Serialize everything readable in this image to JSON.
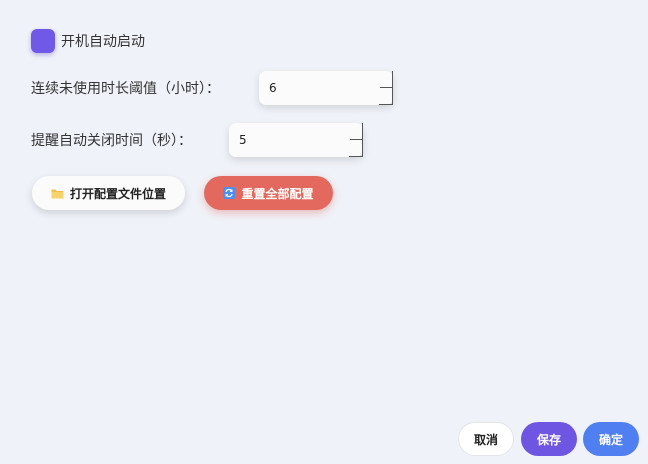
{
  "autostart": {
    "checked": true,
    "label": "开机自动启动",
    "color": "#7159e8"
  },
  "settings": [
    {
      "label": "连续未使用时长阈值（小时）：",
      "value": "6"
    },
    {
      "label": "提醒自动关闭时间（秒）：",
      "value": "5"
    }
  ],
  "actions": {
    "open_config_label": "打开配置文件位置",
    "open_config_icon": "folder-icon",
    "reset_label": "重置全部配置",
    "reset_icon": "refresh-icon",
    "reset_color": "#e3685d"
  },
  "footer": {
    "cancel_label": "取消",
    "save_label": "保存",
    "ok_label": "确定",
    "save_color": "#6f56e2",
    "ok_color": "#4f7ff0"
  }
}
